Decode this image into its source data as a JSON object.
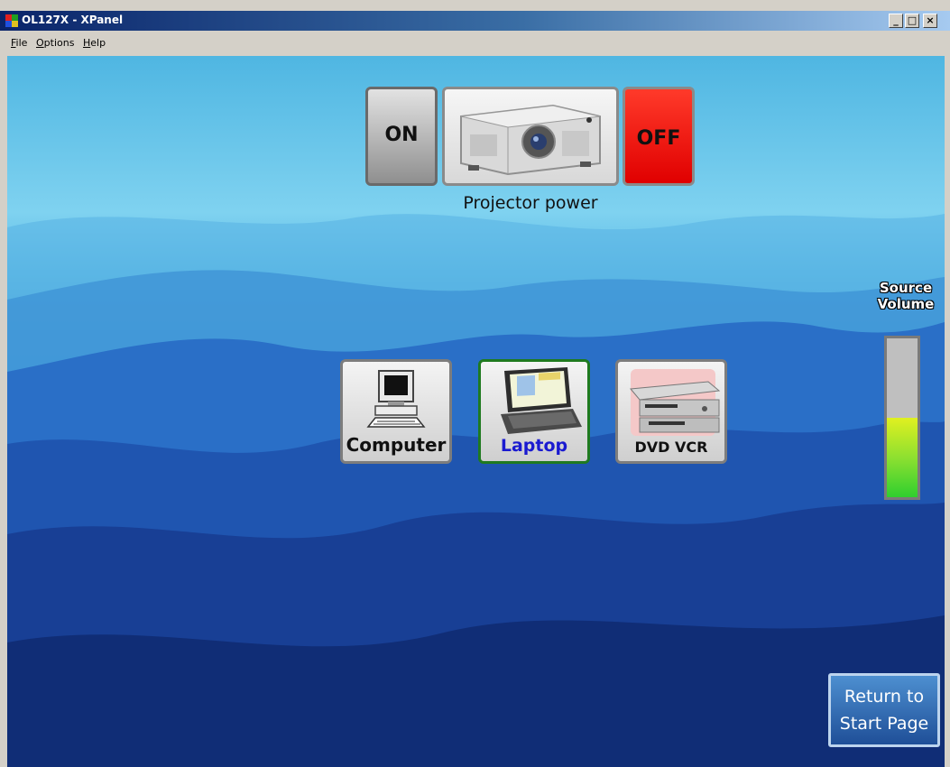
{
  "window": {
    "title": "OL127X - XPanel",
    "minimize_label": "_",
    "maximize_label": "□",
    "close_label": "×"
  },
  "menu": [
    {
      "key": "F",
      "rest": "ile"
    },
    {
      "key": "O",
      "rest": "ptions"
    },
    {
      "key": "H",
      "rest": "elp"
    }
  ],
  "projector": {
    "on_label": "ON",
    "off_label": "OFF",
    "caption": "Projector power"
  },
  "sources": {
    "computer": "Computer",
    "laptop": "Laptop",
    "dvd": "DVD VCR",
    "selected": "laptop"
  },
  "volume": {
    "title_line1": "Source",
    "title_line2": "Volume",
    "level_percent": 50
  },
  "return_button": {
    "line1": "Return to",
    "line2": "Start Page"
  },
  "colors": {
    "off_red": "#ff1a0a",
    "laptop_label": "#1a1ad0",
    "volume_green": "#2fcf2f"
  }
}
